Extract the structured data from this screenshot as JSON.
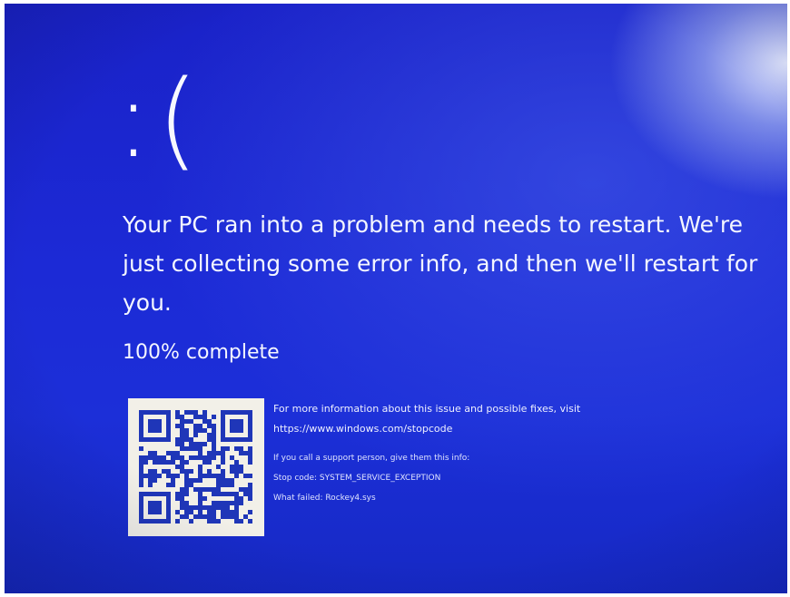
{
  "sad_face": ":(",
  "message": "Your PC ran into a problem and needs to restart. We're just collecting some error info, and then we'll restart for you.",
  "progress": {
    "text": "100% complete",
    "percent": 100
  },
  "info": {
    "more_info": "For more information about this issue and possible fixes, visit",
    "url": "https://www.windows.com/stopcode",
    "support_prompt": "If you call a support person, give them this info:",
    "stop_code": "Stop code: SYSTEM_SERVICE_EXCEPTION",
    "what_failed": "What failed: Rockey4.sys"
  },
  "colors": {
    "background": "#1c2ad6",
    "text": "#f4f6ff",
    "qr_dark": "#1f36b8",
    "qr_light": "#f2f0e8"
  },
  "icons": {
    "qr": "qr-code-icon"
  }
}
